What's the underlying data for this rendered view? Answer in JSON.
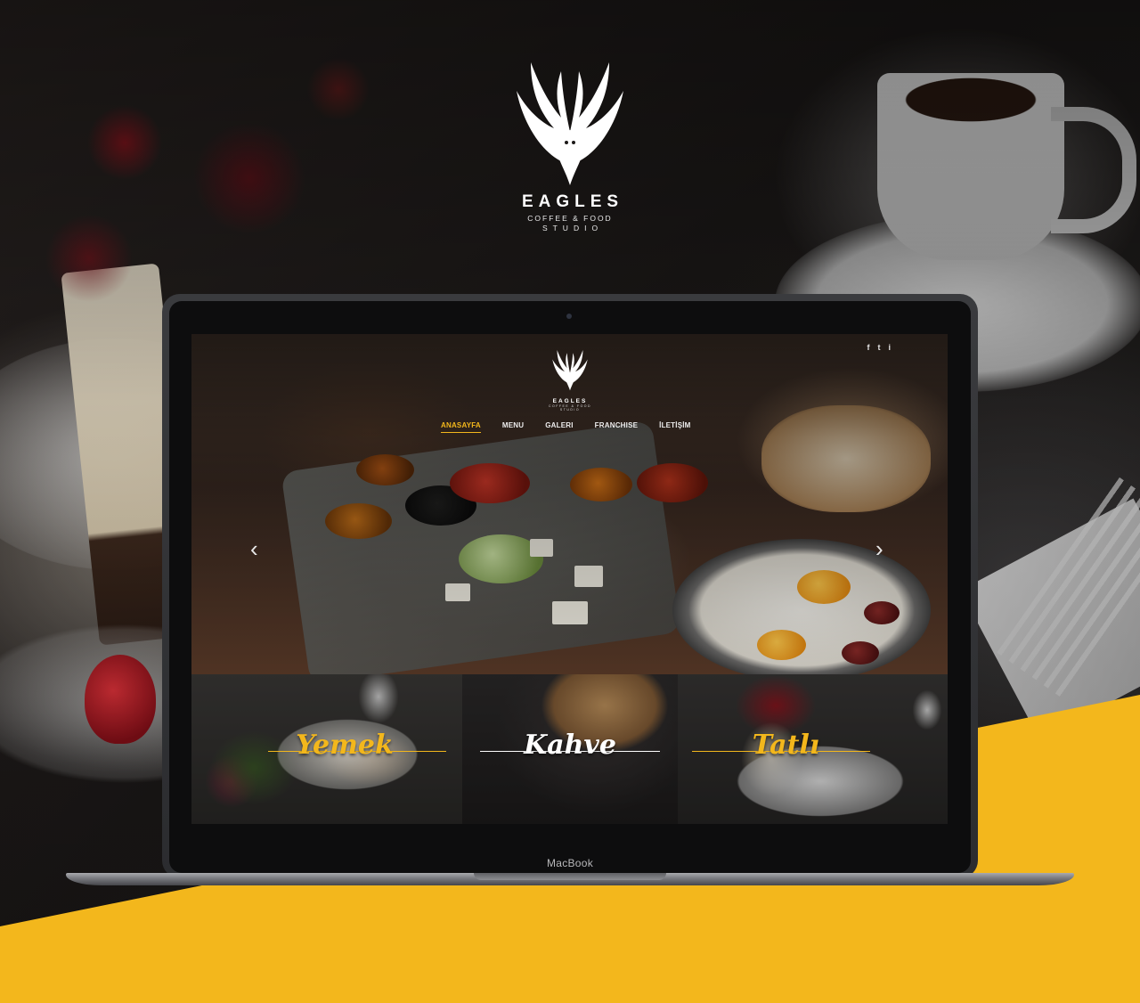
{
  "brand": {
    "name": "EAGLES",
    "tagline": "COFFEE & FOOD",
    "subtitle": "STUDIO"
  },
  "site": {
    "logo_name": "EAGLES",
    "logo_tagline": "COFFEE & FOOD STUDIO",
    "social": [
      "f",
      "t",
      "i"
    ],
    "nav": [
      {
        "label": "ANASAYFA",
        "active": true
      },
      {
        "label": "MENU",
        "active": false
      },
      {
        "label": "GALERI",
        "active": false
      },
      {
        "label": "FRANCHISE",
        "active": false
      },
      {
        "label": "İLETİŞİM",
        "active": false
      }
    ],
    "slider": {
      "prev": "‹",
      "next": "›"
    },
    "tiles": [
      {
        "label": "Yemek",
        "color": "#f3b71c"
      },
      {
        "label": "Kahve",
        "color": "#ffffff"
      },
      {
        "label": "Tatlı",
        "color": "#f3b71c"
      }
    ]
  },
  "device": {
    "label": "MacBook"
  },
  "colors": {
    "accent": "#f3b71c",
    "background": "#1a1817"
  }
}
